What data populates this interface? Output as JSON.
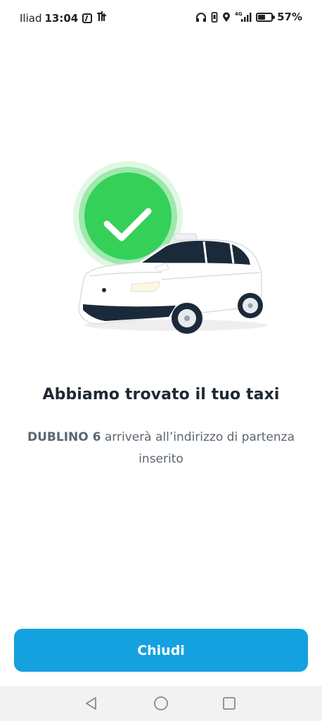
{
  "status_bar": {
    "carrier": "Iliad",
    "time": "13:04",
    "network": "4G",
    "battery_percent": "57%",
    "battery_level": 0.57,
    "icons": [
      "nfc-icon",
      "app-notification-icon",
      "headphones-icon",
      "vibrate-icon",
      "location-icon",
      "signal-icon",
      "battery-icon"
    ]
  },
  "illustration": {
    "icons": [
      "success-check-icon",
      "taxi-car-icon"
    ],
    "colors": {
      "check_circle": "#34d058",
      "check_halo": "#d9f7de",
      "car_body": "#ffffff",
      "car_window": "#1b2a3a"
    }
  },
  "content": {
    "title": "Abbiamo trovato il tuo taxi",
    "driver_name": "DUBLINO 6",
    "message_rest": " arriverà all’indirizzo di partenza inserito"
  },
  "actions": {
    "close_label": "Chiudi",
    "close_color": "#14a1e0"
  },
  "navigation_bar": {
    "icons": [
      "back-icon",
      "home-icon",
      "recents-icon"
    ]
  }
}
